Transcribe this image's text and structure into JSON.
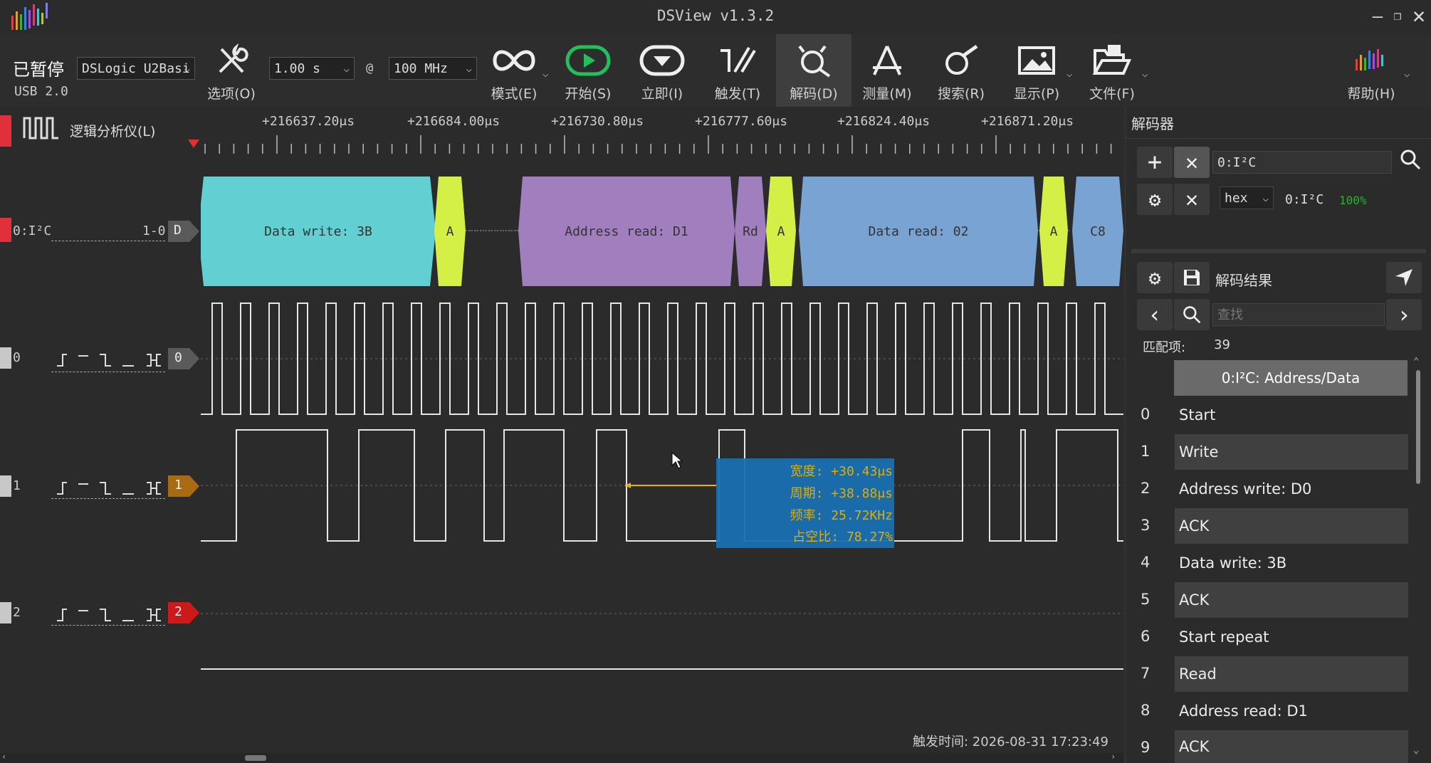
{
  "window": {
    "title": "DSView v1.3.2"
  },
  "toolbar": {
    "status": "已暂停",
    "usb": "USB 2.0",
    "device": "DSLogic U2Basi",
    "duration": "1.00 s",
    "at": "@",
    "rate": "100 MHz",
    "options": "选项(O)",
    "mode": "模式(E)",
    "start": "开始(S)",
    "instant": "立即(I)",
    "trigger": "触发(T)",
    "decode": "解码(D)",
    "measure": "测量(M)",
    "search": "搜索(R)",
    "display": "显示(P)",
    "file": "文件(F)",
    "help": "帮助(H)"
  },
  "ruler": {
    "title": "逻辑分析仪(L)",
    "ticks": [
      "+216637.20μs",
      "+216684.00μs",
      "+216730.80μs",
      "+216777.60μs",
      "+216824.40μs",
      "+216871.20μs"
    ]
  },
  "channels": {
    "decoder_label": "0:I²C",
    "decoder_range": "1-0",
    "decoder_tag": "D",
    "ch0": "0",
    "ch1": "1",
    "ch2": "2"
  },
  "decode_blocks": [
    {
      "text": "Data write: 3B"
    },
    {
      "text": "A"
    },
    {
      "text": "Address read: D1"
    },
    {
      "text": "Rd"
    },
    {
      "text": "A"
    },
    {
      "text": "Data read: 02"
    },
    {
      "text": "A"
    },
    {
      "text": "C8"
    }
  ],
  "measure": {
    "width": "宽度: +30.43μs",
    "period": "周期: +38.88μs",
    "freq": "频率: 25.72KHz",
    "duty": "占空比: 78.27%"
  },
  "status_bar": {
    "trigger_time": "触发时间: 2026-08-31 17:23:49"
  },
  "panel": {
    "title": "解码器",
    "decoder_name": "0:I²C",
    "format": "hex",
    "decoder_status_name": "0:I²C",
    "progress": "100%",
    "results_title": "解码结果",
    "search_placeholder": "查找",
    "match_label": "匹配项:",
    "match_count": "39",
    "column_header": "0:I²C: Address/Data",
    "results": [
      {
        "n": "0",
        "t": "Start"
      },
      {
        "n": "1",
        "t": "Write"
      },
      {
        "n": "2",
        "t": "Address write: D0"
      },
      {
        "n": "3",
        "t": "ACK"
      },
      {
        "n": "4",
        "t": "Data write: 3B"
      },
      {
        "n": "5",
        "t": "ACK"
      },
      {
        "n": "6",
        "t": "Start repeat"
      },
      {
        "n": "7",
        "t": "Read"
      },
      {
        "n": "8",
        "t": "Address read: D1"
      },
      {
        "n": "9",
        "t": "ACK"
      }
    ]
  },
  "colors": {
    "data_write": "#62d0d2",
    "ack": "#d4ef45",
    "address_read": "#a17fbf",
    "data_read": "#79a3d3",
    "measure_box": "#1a6fb0",
    "measure_text": "#e8b400"
  }
}
